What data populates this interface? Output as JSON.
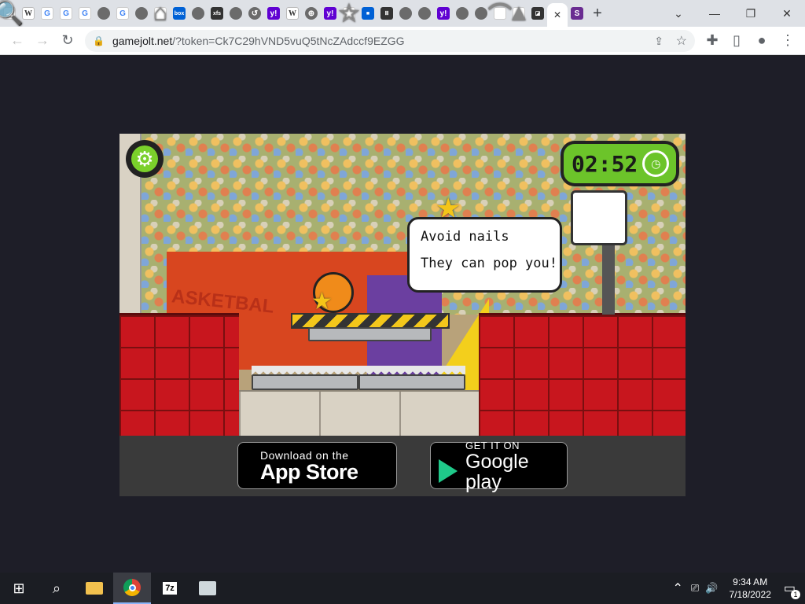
{
  "browser": {
    "tabs": [
      {
        "icon": "search-icon",
        "glyph": "🔍"
      },
      {
        "icon": "wikipedia-icon",
        "glyph": "W"
      },
      {
        "icon": "google-icon",
        "glyph": "G"
      },
      {
        "icon": "google-icon",
        "glyph": "G"
      },
      {
        "icon": "google-icon",
        "glyph": "G"
      },
      {
        "icon": "globe-icon",
        "glyph": ""
      },
      {
        "icon": "google-icon",
        "glyph": "G"
      },
      {
        "icon": "globe-icon",
        "glyph": ""
      },
      {
        "icon": "home-icon",
        "glyph": "⌂"
      },
      {
        "icon": "box-icon",
        "glyph": "box"
      },
      {
        "icon": "globe-icon",
        "glyph": ""
      },
      {
        "icon": "xfs-icon",
        "glyph": "xfs"
      },
      {
        "icon": "globe-icon",
        "glyph": ""
      },
      {
        "icon": "history-icon",
        "glyph": "↺"
      },
      {
        "icon": "yahoo-icon",
        "glyph": "y!"
      },
      {
        "icon": "wikipedia-icon",
        "glyph": "W"
      },
      {
        "icon": "globe-icon",
        "glyph": "⊕"
      },
      {
        "icon": "yahoo-icon",
        "glyph": "y!"
      },
      {
        "icon": "star-icon",
        "glyph": "☆"
      },
      {
        "icon": "square-icon",
        "glyph": "■"
      },
      {
        "icon": "museum-icon",
        "glyph": "Ⅲ"
      },
      {
        "icon": "globe-icon",
        "glyph": ""
      },
      {
        "icon": "globe-icon",
        "glyph": ""
      },
      {
        "icon": "yahoo-icon",
        "glyph": "y!"
      },
      {
        "icon": "earth-icon",
        "glyph": ""
      },
      {
        "icon": "earth-icon",
        "glyph": ""
      },
      {
        "icon": "rainbow-icon",
        "glyph": "⌒"
      },
      {
        "icon": "hat-icon",
        "glyph": "▲"
      },
      {
        "icon": "game-icon",
        "glyph": "◪"
      }
    ],
    "extra_tab_icon": "s-icon",
    "extra_tab_glyph": "S",
    "active_tab_close": "✕",
    "new_tab": "+",
    "url_host": "gamejolt.net",
    "url_rest": "/?token=Ck7C29hVND5vuQ5tNcZAdccf9EZGG"
  },
  "game": {
    "timer": "02:52",
    "bubble_line1": "Avoid nails",
    "bubble_line2": "They can pop you!",
    "banner_text": "ASKETBAL",
    "app_store_small": "Download on the",
    "app_store_big": "App Store",
    "google_small": "GET IT ON",
    "google_big": "Google play"
  },
  "taskbar": {
    "time": "9:34 AM",
    "date": "7/18/2022",
    "notification_count": "1"
  }
}
